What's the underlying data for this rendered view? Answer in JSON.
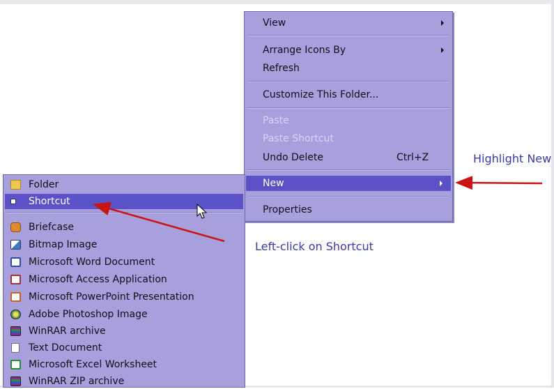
{
  "context_menu": {
    "items": [
      {
        "label": "View",
        "has_submenu": true,
        "disabled": false
      },
      {
        "label": "Arrange Icons By",
        "has_submenu": true,
        "disabled": false
      },
      {
        "label": "Refresh",
        "has_submenu": false,
        "disabled": false
      },
      {
        "label": "Customize This Folder...",
        "has_submenu": false,
        "disabled": false
      },
      {
        "label": "Paste",
        "has_submenu": false,
        "disabled": true
      },
      {
        "label": "Paste Shortcut",
        "has_submenu": false,
        "disabled": true
      },
      {
        "label": "Undo Delete",
        "shortcut": "Ctrl+Z",
        "has_submenu": false,
        "disabled": false
      },
      {
        "label": "New",
        "has_submenu": true,
        "disabled": false,
        "highlighted": true
      },
      {
        "label": "Properties",
        "has_submenu": false,
        "disabled": false
      }
    ]
  },
  "new_submenu": {
    "items": [
      {
        "label": "Folder",
        "icon": "folder-icon"
      },
      {
        "label": "Shortcut",
        "icon": "shortcut-icon",
        "highlighted": true
      },
      {
        "label": "Briefcase",
        "icon": "briefcase-icon"
      },
      {
        "label": "Bitmap Image",
        "icon": "bitmap-icon"
      },
      {
        "label": "Microsoft Word Document",
        "icon": "word-icon"
      },
      {
        "label": "Microsoft Access Application",
        "icon": "access-icon"
      },
      {
        "label": "Microsoft PowerPoint Presentation",
        "icon": "powerpoint-icon"
      },
      {
        "label": "Adobe Photoshop Image",
        "icon": "photoshop-icon"
      },
      {
        "label": "WinRAR archive",
        "icon": "winrar-icon"
      },
      {
        "label": "Text Document",
        "icon": "text-document-icon"
      },
      {
        "label": "Microsoft Excel Worksheet",
        "icon": "excel-icon"
      },
      {
        "label": "WinRAR ZIP archive",
        "icon": "winrar-zip-icon"
      }
    ]
  },
  "annotations": {
    "highlight_new": "Highlight New",
    "left_click_shortcut": "Left-click on Shortcut"
  },
  "colors": {
    "menu_bg": "#a8a0dc",
    "highlight": "#5c52c8",
    "annotation_text": "#3a38a8",
    "arrow": "#c81414"
  }
}
